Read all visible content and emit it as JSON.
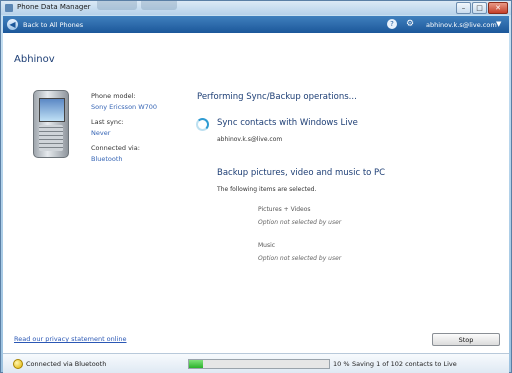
{
  "window": {
    "title": "Phone Data Manager"
  },
  "navbar": {
    "back_label": "Back to All Phones",
    "help_icon": "help-icon",
    "settings_icon": "gear-icon",
    "account": "abhinov.k.s@live.com"
  },
  "device": {
    "name": "Abhinov",
    "model_label": "Phone model:",
    "model_value": "Sony Ericsson W700",
    "sync_label": "Last sync:",
    "sync_value": "Never",
    "conn_label": "Connected via:",
    "conn_value": "Bluetooth"
  },
  "sync": {
    "heading": "Performing Sync/Backup operations...",
    "contacts": {
      "title": "Sync contacts with Windows Live",
      "account": "abhinov.k.s@live.com"
    },
    "backup": {
      "title": "Backup pictures, video and music to PC",
      "subtitle": "The following items are selected.",
      "items": [
        {
          "title": "Pictures + Videos",
          "status": "Option not selected by user"
        },
        {
          "title": "Music",
          "status": "Option not selected by user"
        }
      ]
    }
  },
  "footer": {
    "privacy_link": "Read our privacy statement online",
    "stop_label": "Stop"
  },
  "status": {
    "connection": "Connected via Bluetooth",
    "progress": 0.1,
    "percent_text": "10 %",
    "message": "Saving 1 of 102 contacts to Live"
  }
}
